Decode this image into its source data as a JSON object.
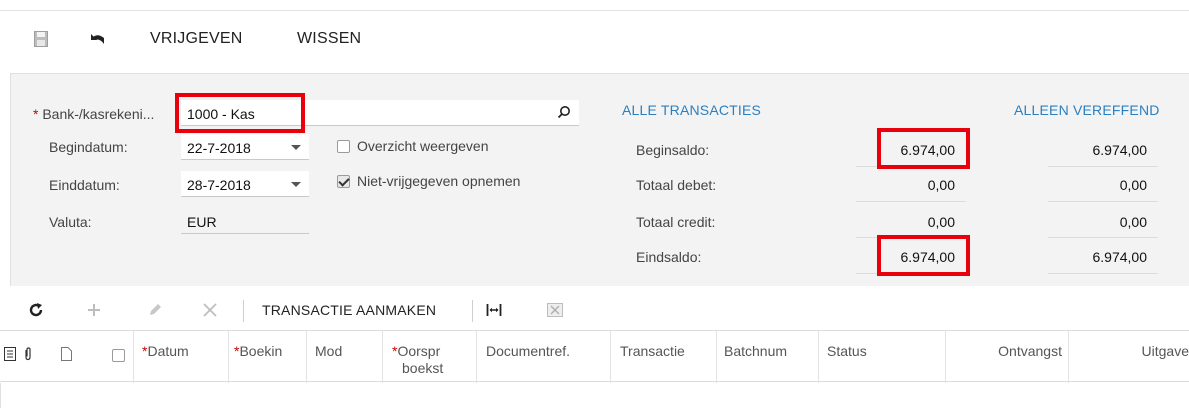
{
  "toolbar": {
    "save_icon": "save-icon",
    "undo_icon": "undo-icon",
    "release_label": "VRIJGEVEN",
    "clear_label": "WISSEN"
  },
  "form": {
    "bank_account_label": "Bank-/kasrekeni...",
    "bank_account_value": "1000 - Kas",
    "start_date_label": "Begindatum:",
    "start_date_value": "22-7-2018",
    "end_date_label": "Einddatum:",
    "end_date_value": "28-7-2018",
    "currency_label": "Valuta:",
    "currency_value": "EUR",
    "show_summary_label": "Overzicht weergeven",
    "show_summary_checked": false,
    "include_unreleased_label": "Niet-vrijgegeven opnemen",
    "include_unreleased_checked": true
  },
  "summary": {
    "all_transactions_label": "ALLE TRANSACTIES",
    "cleared_only_label": "ALLEEN VEREFFEND",
    "rows": [
      {
        "label": "Beginsaldo:",
        "all": "6.974,00",
        "cleared": "6.974,00"
      },
      {
        "label": "Totaal debet:",
        "all": "0,00",
        "cleared": "0,00"
      },
      {
        "label": "Totaal credit:",
        "all": "0,00",
        "cleared": "0,00"
      },
      {
        "label": "Eindsaldo:",
        "all": "6.974,00",
        "cleared": "6.974,00"
      }
    ]
  },
  "grid_toolbar": {
    "create_transaction_label": "TRANSACTIE AANMAKEN"
  },
  "grid": {
    "columns": {
      "date": "Datum",
      "batch_entry": "Boekin",
      "module": "Mod",
      "orig_line1": "Oorspr",
      "orig_line2": "boekst",
      "docref": "Documentref.",
      "transaction": "Transactie",
      "batchnum": "Batchnum",
      "status": "Status",
      "receipt": "Ontvangst",
      "payment": "Uitgave"
    }
  },
  "colors": {
    "accent_link": "#2a7fc1",
    "highlight_box": "#e8000d",
    "required": "#cc0000"
  }
}
